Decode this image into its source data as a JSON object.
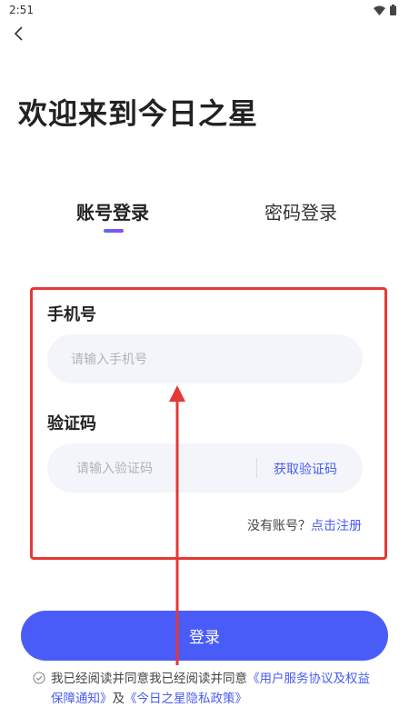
{
  "status_bar": {
    "time": "2:51",
    "icons": [
      "wifi-icon",
      "battery-icon"
    ]
  },
  "header": {
    "back_icon": "chevron-left-icon"
  },
  "title": "欢迎来到今日之星",
  "tabs": [
    {
      "label": "账号登录",
      "active": true
    },
    {
      "label": "密码登录",
      "active": false
    }
  ],
  "form": {
    "phone_label": "手机号",
    "phone_placeholder": "请输入手机号",
    "code_label": "验证码",
    "code_placeholder": "请输入验证码",
    "get_code_label": "获取验证码",
    "no_account": "没有账号？",
    "register_link": "点击注册"
  },
  "login_button": "登录",
  "agreement": {
    "prefix": "我已经阅读并同意我已经阅读并同意",
    "user_agreement": "《用户服务协议及权益保障通知》",
    "and": "及",
    "privacy_policy": "《今日之星隐私政策》"
  },
  "colors": {
    "accent": "#4a5cf8",
    "link": "#4a5cf0",
    "annotation": "#e53935",
    "input_bg": "#f3f5fb"
  }
}
